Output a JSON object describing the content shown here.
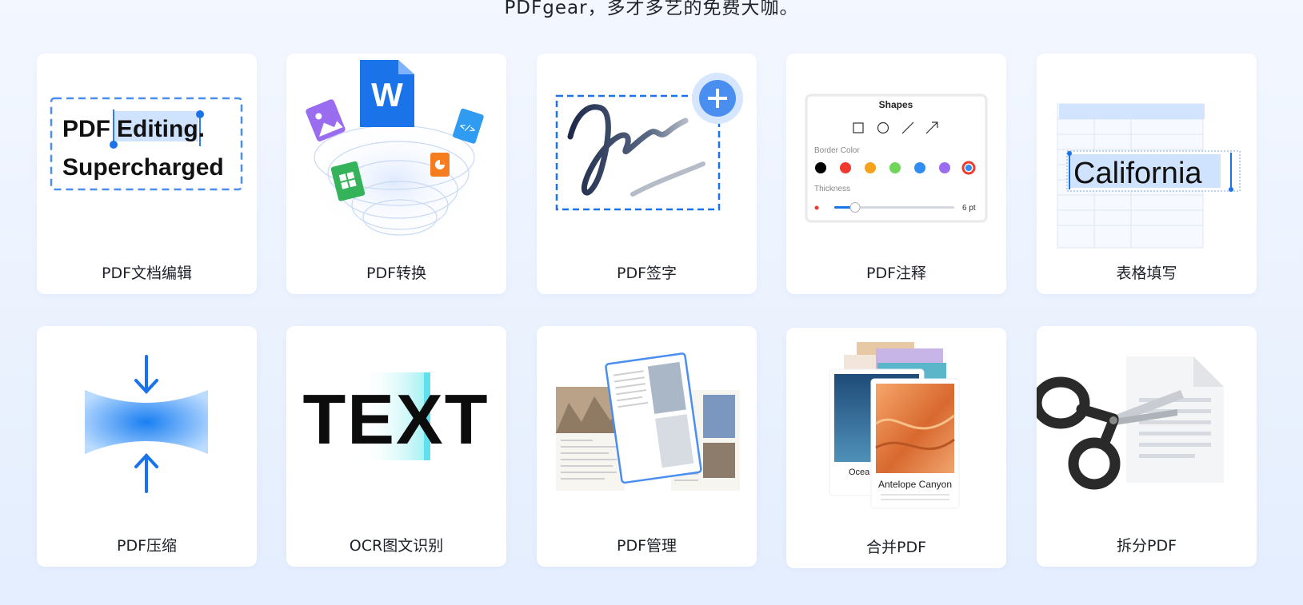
{
  "header": {
    "headline": "PDFgear，多才多艺的免费大咖。"
  },
  "tools": [
    {
      "id": "edit",
      "label": "PDF文档编辑",
      "art": {
        "line1": "PDF",
        "line1b": "Editing.",
        "line2": "Supercharged"
      }
    },
    {
      "id": "convert",
      "label": "PDF转换",
      "art": {
        "word_letter": "W",
        "code_glyph": "</>"
      }
    },
    {
      "id": "sign",
      "label": "PDF签字",
      "art": {
        "plus": "+"
      }
    },
    {
      "id": "annotate",
      "label": "PDF注释",
      "art": {
        "shapes_title": "Shapes",
        "border_color": "Border Color",
        "thickness": "Thickness",
        "thickness_value": "6 pt",
        "swatches": [
          "#000000",
          "#f03a2e",
          "#f7a21b",
          "#6fd65a",
          "#2f8cf2",
          "#9a6cf0"
        ]
      }
    },
    {
      "id": "form",
      "label": "表格填写",
      "art": {
        "word": "California"
      }
    },
    {
      "id": "compress",
      "label": "PDF压缩",
      "art": {}
    },
    {
      "id": "ocr",
      "label": "OCR图文识别",
      "art": {
        "word": "TEXT"
      }
    },
    {
      "id": "manage",
      "label": "PDF管理",
      "art": {}
    },
    {
      "id": "merge",
      "label": "合并PDF",
      "art": {
        "back_caption": "Ocea",
        "front_caption": "Antelope Canyon"
      }
    },
    {
      "id": "split",
      "label": "拆分PDF",
      "art": {}
    }
  ],
  "colors": {
    "accent": "#1a73e8",
    "light_blue": "#cfe3ff"
  }
}
